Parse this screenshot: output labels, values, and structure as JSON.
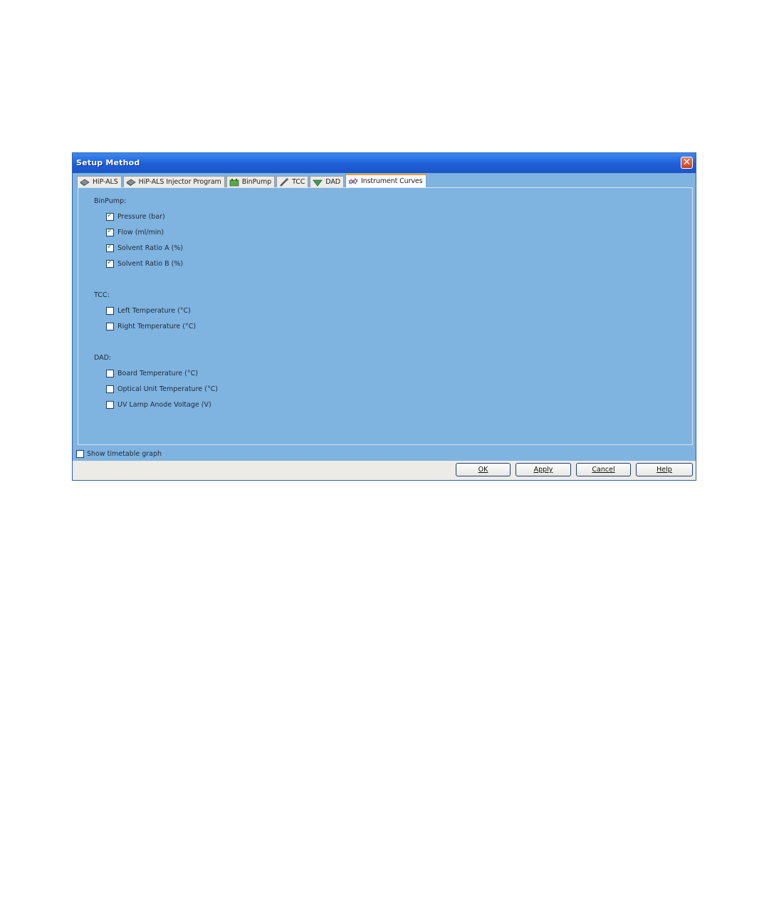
{
  "window": {
    "title": "Setup Method"
  },
  "tabs": [
    {
      "label": "HiP-ALS",
      "icon": "sampler-icon",
      "active": false
    },
    {
      "label": "HiP-ALS Injector Program",
      "icon": "sampler-icon",
      "active": false
    },
    {
      "label": "BinPump",
      "icon": "pump-icon",
      "active": false
    },
    {
      "label": "TCC",
      "icon": "column-icon",
      "active": false
    },
    {
      "label": "DAD",
      "icon": "detector-icon",
      "active": false
    },
    {
      "label": "Instrument Curves",
      "icon": "curves-icon",
      "active": true
    }
  ],
  "sections": {
    "binpump": {
      "label": "BinPump:",
      "items": [
        {
          "label": "Pressure (bar)",
          "checked": true
        },
        {
          "label": "Flow (ml/min)",
          "checked": true
        },
        {
          "label": "Solvent Ratio A (%)",
          "checked": true
        },
        {
          "label": "Solvent Ratio B (%)",
          "checked": true
        }
      ]
    },
    "tcc": {
      "label": "TCC:",
      "items": [
        {
          "label": "Left Temperature (°C)",
          "checked": false
        },
        {
          "label": "Right Temperature (°C)",
          "checked": false
        }
      ]
    },
    "dad": {
      "label": "DAD:",
      "items": [
        {
          "label": "Board Temperature (°C)",
          "checked": false
        },
        {
          "label": "Optical Unit Temperature (°C)",
          "checked": false
        },
        {
          "label": "UV Lamp Anode Voltage (V)",
          "checked": false
        }
      ]
    }
  },
  "show_timetable": {
    "label": "Show timetable graph",
    "checked": false
  },
  "buttons": {
    "ok": "OK",
    "apply": "Apply",
    "cancel": "Cancel",
    "help": "Help"
  },
  "colors": {
    "panel": "#7fb3e0",
    "titlebar": "#1f5fd8",
    "active_tab_accent": "#f0a030"
  }
}
